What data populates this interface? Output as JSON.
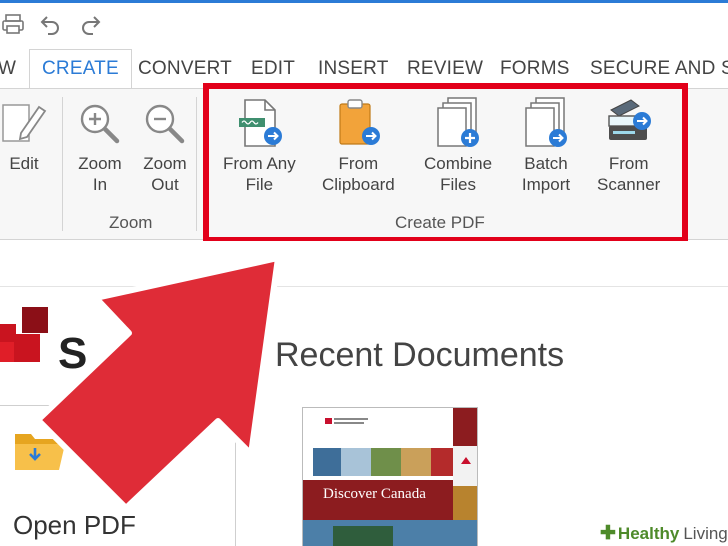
{
  "colors": {
    "accent": "#2b7bd6",
    "highlight": "#e2001a",
    "arrow": "#df2c37",
    "watermark": "#4e8a2a"
  },
  "quick_access": [
    {
      "icon": "printer-icon"
    },
    {
      "icon": "undo-icon"
    },
    {
      "icon": "redo-icon"
    }
  ],
  "tabs": [
    {
      "label": "W",
      "active": false
    },
    {
      "label": "CREATE",
      "active": true
    },
    {
      "label": "CONVERT",
      "active": false
    },
    {
      "label": "EDIT",
      "active": false
    },
    {
      "label": "INSERT",
      "active": false
    },
    {
      "label": "REVIEW",
      "active": false
    },
    {
      "label": "FORMS",
      "active": false
    },
    {
      "label": "SECURE AND SIG",
      "active": false
    }
  ],
  "ribbon": {
    "edit": {
      "label": "Edit",
      "icon": "pencil-icon"
    },
    "zoom_group": {
      "label": "Zoom",
      "zoom_in": {
        "line1": "Zoom",
        "line2": "In",
        "icon": "zoom-in-icon"
      },
      "zoom_out": {
        "line1": "Zoom",
        "line2": "Out",
        "icon": "zoom-out-icon"
      }
    },
    "create_group": {
      "label": "Create PDF",
      "from_any_file": {
        "line1": "From Any",
        "line2": "File",
        "icon": "file-convert-icon"
      },
      "from_clipboard": {
        "line1": "From",
        "line2": "Clipboard",
        "icon": "clipboard-icon"
      },
      "combine_files": {
        "line1": "Combine",
        "line2": "Files",
        "icon": "combine-files-icon"
      },
      "batch_import": {
        "line1": "Batch",
        "line2": "Import",
        "icon": "batch-import-icon"
      },
      "from_scanner": {
        "line1": "From",
        "line2": "Scanner",
        "icon": "scanner-icon"
      }
    }
  },
  "main": {
    "logo_text": "S",
    "recent_title": "Recent Documents",
    "open_pdf_label": "Open PDF",
    "thumbnail": {
      "title": "Discover Canada"
    }
  },
  "watermark": {
    "part1": "Healthy",
    "part2": "Living"
  }
}
